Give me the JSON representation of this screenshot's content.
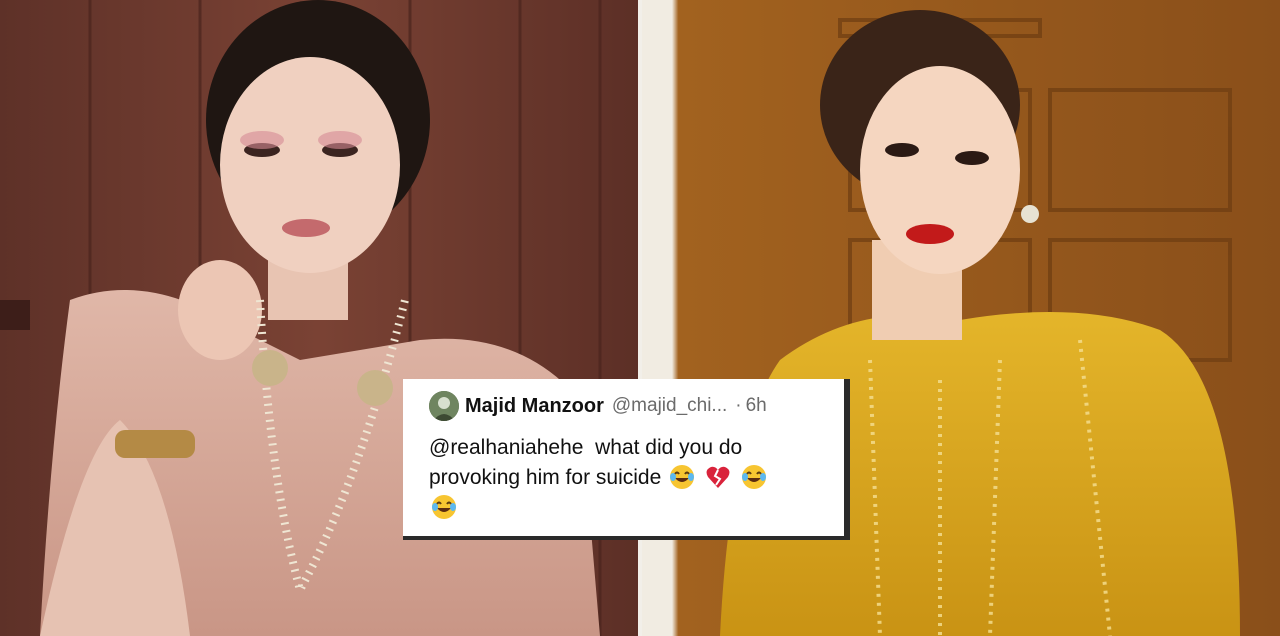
{
  "photos": {
    "left": {
      "icon": "portrait-photo-pink-saree"
    },
    "right": {
      "icon": "portrait-photo-mustard-outfit"
    }
  },
  "comment": {
    "author": "Majid Manzoor",
    "handle": "@majid_chi...",
    "separator": "·",
    "time": "6h",
    "mention": "@realhaniahehe",
    "text": "what did you do provoking him for suicide",
    "emojis": [
      "tears-of-joy-emoji",
      "broken-heart-emoji",
      "tears-of-joy-emoji",
      "tears-of-joy-emoji"
    ]
  },
  "colors": {
    "left_bg": "#6e3b30",
    "right_bg": "#9a5a1c",
    "outfit_left": "#d6a99a",
    "outfit_right": "#d9a91e",
    "card_bg": "#ffffff"
  }
}
